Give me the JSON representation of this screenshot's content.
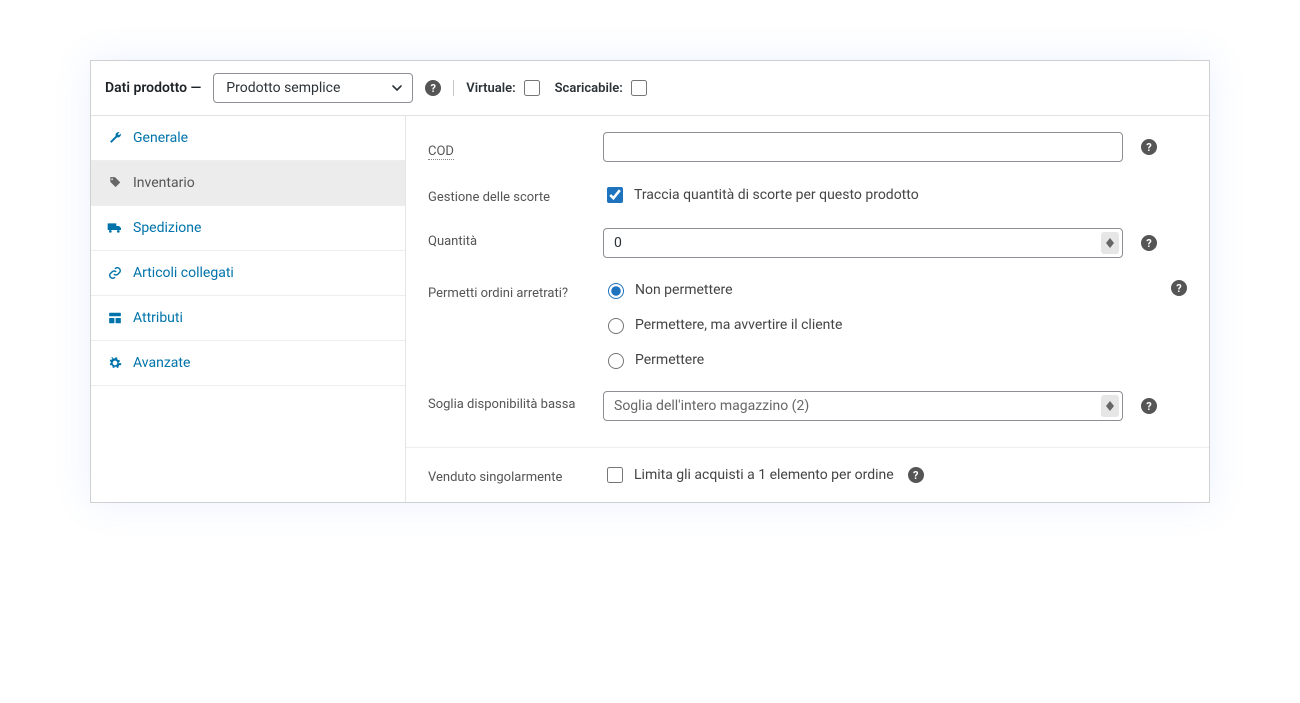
{
  "header": {
    "title_prefix": "Dati prodotto —",
    "product_type": "Prodotto semplice",
    "virtual_label": "Virtuale:",
    "downloadable_label": "Scaricabile:"
  },
  "tabs": {
    "general": "Generale",
    "inventory": "Inventario",
    "shipping": "Spedizione",
    "linked": "Articoli collegati",
    "attributes": "Attributi",
    "advanced": "Avanzate"
  },
  "inventory": {
    "sku_label": "COD",
    "sku_value": "",
    "stock_mgmt_label": "Gestione delle scorte",
    "stock_mgmt_checkbox": "Traccia quantità di scorte per questo prodotto",
    "quantity_label": "Quantità",
    "quantity_value": "0",
    "backorders_label": "Permetti ordini arretrati?",
    "backorders_options": {
      "no": "Non permettere",
      "notify": "Permettere, ma avvertire il cliente",
      "yes": "Permettere"
    },
    "low_stock_label": "Soglia disponibilità bassa",
    "low_stock_value": "Soglia dell'intero magazzino (2)",
    "sold_ind_label": "Venduto singolarmente",
    "sold_ind_checkbox": "Limita gli acquisti a 1 elemento per ordine"
  }
}
